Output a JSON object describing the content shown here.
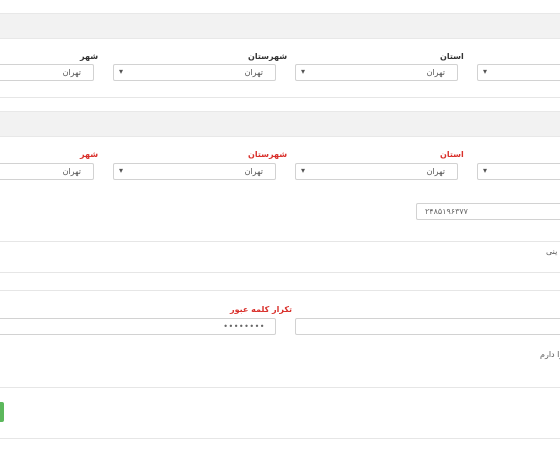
{
  "section1": {
    "province_label": "استان",
    "county_label": "شهرستان",
    "city_label": "شهر",
    "province_value": "تهران",
    "county_value": "تهران",
    "city_value": "تهران"
  },
  "section2": {
    "province_label": "استان",
    "county_label": "شهرستان",
    "city_label": "شهر",
    "province_value": "تهران",
    "county_value": "تهران",
    "city_value": "تهران"
  },
  "phone": {
    "value": "۲۴۸۵۱۹۶۳۷۷"
  },
  "partial_text_1": "ینی",
  "password_repeat": {
    "label": "تکرار کلمه عبور",
    "value": "••••••••"
  },
  "partial_text_2": "را دارم",
  "icons": {
    "dropdown": "chevron-down-icon"
  },
  "colors": {
    "required_label": "#d9302b",
    "submit": "#5cb85c",
    "band": "#f2f2f2"
  }
}
